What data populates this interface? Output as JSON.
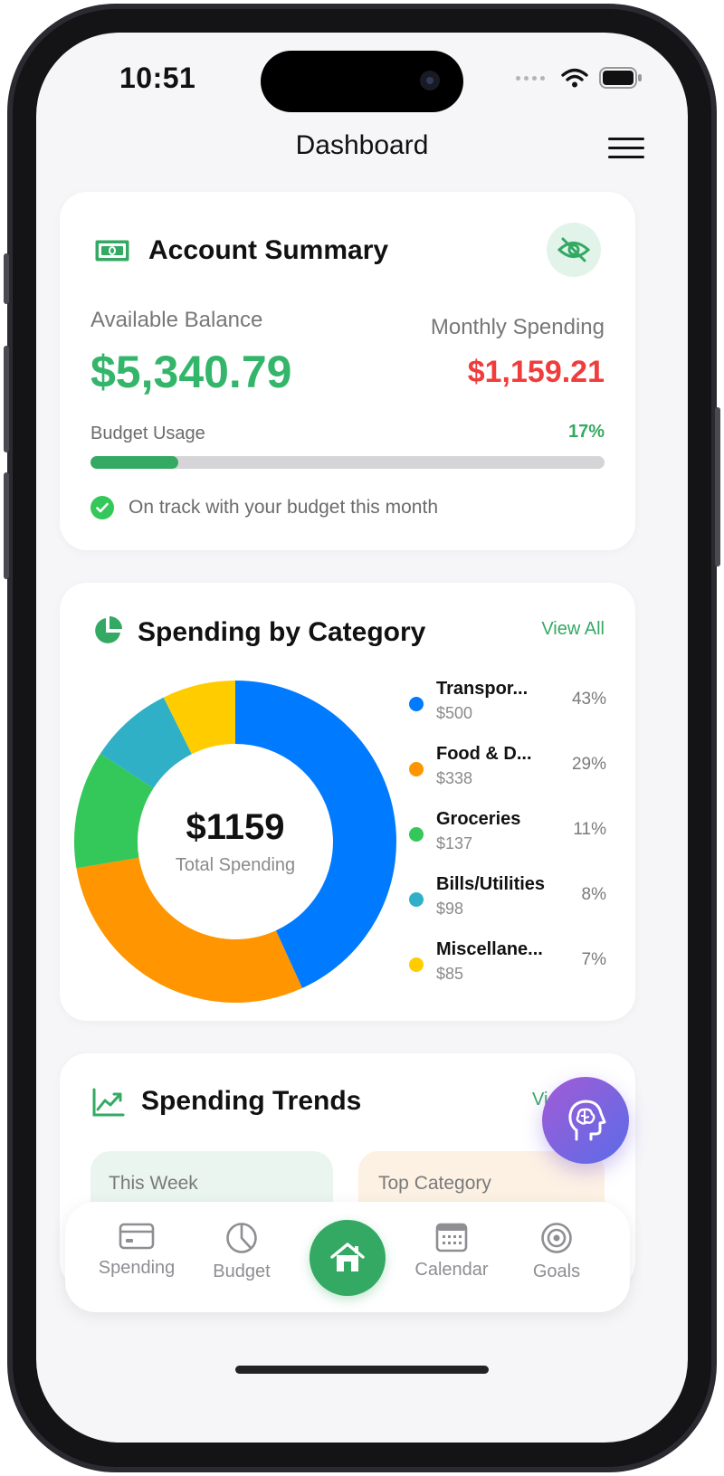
{
  "status_bar": {
    "time": "10:51"
  },
  "nav": {
    "title": "Dashboard"
  },
  "account_summary": {
    "title": "Account Summary",
    "available_balance_label": "Available Balance",
    "available_balance": "$5,340.79",
    "monthly_spending_label": "Monthly Spending",
    "monthly_spending": "$1,159.21",
    "budget_usage_label": "Budget Usage",
    "budget_usage_pct": "17%",
    "budget_usage_fraction": 0.17,
    "status_message": "On track with your budget this month"
  },
  "spending_by_category": {
    "title": "Spending by Category",
    "view_all": "View All",
    "total": "$1159",
    "total_label": "Total Spending",
    "categories": [
      {
        "name": "Transpor...",
        "amount": "$500",
        "pct": "43%",
        "value": 500,
        "color": "#007aff"
      },
      {
        "name": "Food & D...",
        "amount": "$338",
        "pct": "29%",
        "value": 338,
        "color": "#ff9500"
      },
      {
        "name": "Groceries",
        "amount": "$137",
        "pct": "11%",
        "value": 137,
        "color": "#34c759"
      },
      {
        "name": "Bills/Utilities",
        "amount": "$98",
        "pct": "8%",
        "value": 98,
        "color": "#30b0c7"
      },
      {
        "name": "Miscellane...",
        "amount": "$85",
        "pct": "7%",
        "value": 85,
        "color": "#ffcc00"
      }
    ]
  },
  "spending_trends": {
    "title": "Spending Trends",
    "view_all_partial": "Vi",
    "this_week_label": "This Week",
    "top_category_label": "Top Category"
  },
  "tab_bar": {
    "spending": "Spending",
    "budget": "Budget",
    "calendar": "Calendar",
    "goals": "Goals"
  },
  "colors": {
    "accent_green": "#34a963",
    "balance_green": "#33b56a",
    "spending_red": "#f13c3c",
    "fab_gradient_start": "#a35bd6",
    "fab_gradient_end": "#5a6ce8"
  },
  "icons": {
    "account": "money-bill-icon",
    "visibility": "eye-slash-icon",
    "check": "checkmark-circle-icon",
    "category": "pie-chart-icon",
    "trends": "trend-line-icon",
    "assistant": "brain-head-icon",
    "menu": "hamburger-menu-icon"
  }
}
